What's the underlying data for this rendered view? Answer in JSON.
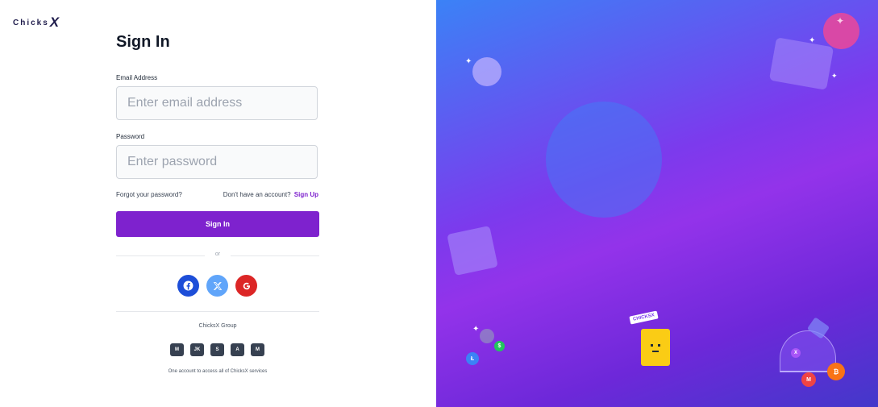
{
  "brand": {
    "name": "Chicks",
    "mark": "X"
  },
  "form": {
    "title": "Sign In",
    "email_label": "Email Address",
    "email_placeholder": "Enter email address",
    "email_value": "",
    "password_label": "Password",
    "password_placeholder": "Enter password",
    "password_value": "",
    "forgot_label": "Forgot your password?",
    "no_account_text": "Don't have an account?",
    "sign_up_label": "Sign Up",
    "submit_label": "Sign In",
    "or_text": "or"
  },
  "social": [
    {
      "name": "facebook",
      "icon": "facebook-icon",
      "color": "#1d4ed8"
    },
    {
      "name": "x",
      "icon": "x-logo-icon",
      "color": "#60a5fa"
    },
    {
      "name": "google",
      "icon": "google-icon",
      "color": "#dc2626"
    }
  ],
  "group": {
    "title": "ChicksX Group",
    "brands": [
      "M",
      "JK",
      "S",
      "A",
      "M"
    ],
    "caption": "One account to access all of ChicksX services"
  },
  "illustration": {
    "badge_text": "CHICKSX",
    "coins": [
      "Ł",
      "$",
      "X",
      "M",
      "₿"
    ]
  },
  "colors": {
    "accent": "#7e22ce",
    "ink": "#1e1b4b"
  }
}
